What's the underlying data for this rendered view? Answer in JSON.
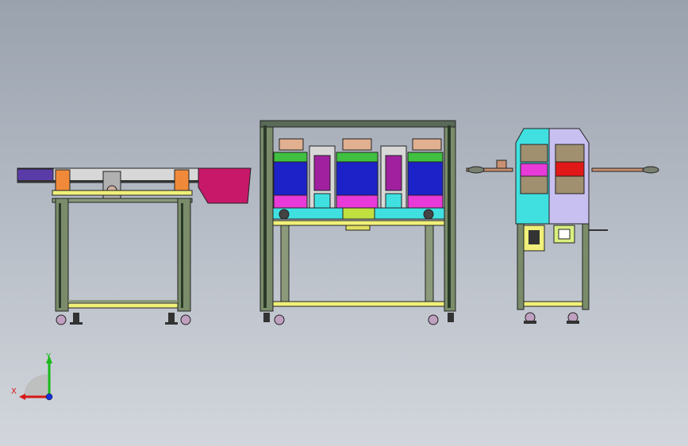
{
  "viewport": {
    "background_top": "#9aa2ae",
    "background_bottom": "#d2d6dc"
  },
  "triad": {
    "x_label": "X",
    "y_label": "Y",
    "x_color": "#d81818",
    "y_color": "#18b818",
    "z_color": "#1830d8"
  },
  "parts": {
    "left": "conveyor-station",
    "center": "triple-press-station",
    "right": "side-view-station"
  },
  "colors": {
    "frame": "#7a8c6a",
    "frame_dark": "#3c4a36",
    "purple": "#5a3ca8",
    "magenta": "#c8186a",
    "orange": "#f08a3a",
    "yellow": "#f0f07a",
    "blue": "#1c22c8",
    "pink": "#e83ad8",
    "cyan": "#40e0e0",
    "red": "#e01818",
    "lavender": "#c8c0f0"
  }
}
